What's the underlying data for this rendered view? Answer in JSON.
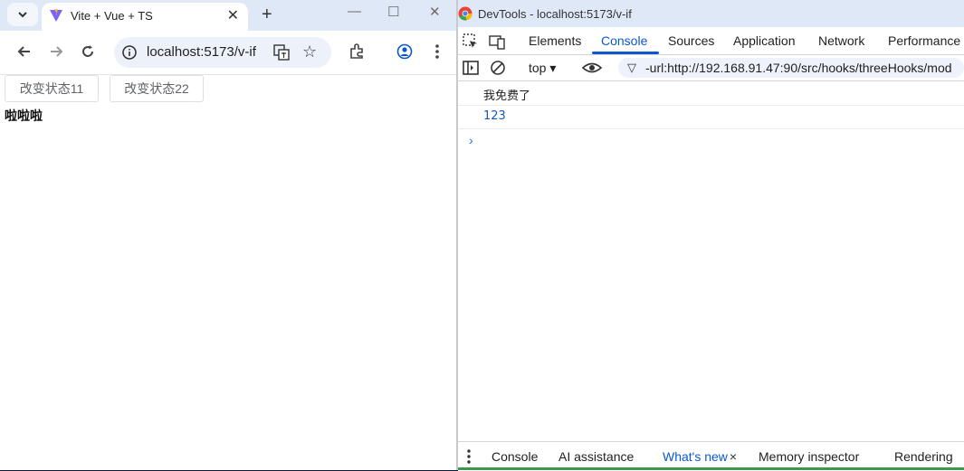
{
  "browser": {
    "tab_title": "Vite + Vue + TS",
    "url": "localhost:5173/v-if",
    "page": {
      "buttons": [
        "改变状态11",
        "改变状态22"
      ],
      "text": "啦啦啦"
    }
  },
  "devtools": {
    "window_title": "DevTools - localhost:5173/v-if",
    "panel_tabs": [
      "Elements",
      "Console",
      "Sources",
      "Application",
      "Network",
      "Performance"
    ],
    "active_panel": "Console",
    "context": "top",
    "filter": "-url:http://192.168.91.47:90/src/hooks/threeHooks/mod",
    "console_lines": [
      {
        "text": "我免费了",
        "color": "#1f1f1f"
      },
      {
        "text": "123",
        "color": "#1a57b8"
      }
    ],
    "prompt": "›",
    "drawer_tabs": [
      "Console",
      "AI assistance",
      "What's new",
      "Memory inspector",
      "Rendering"
    ],
    "active_drawer": "What's new",
    "drawer_close": "×"
  },
  "icons": {
    "tab_search": "chevron-down-icon",
    "new_tab": "+",
    "minimize": "—",
    "maximize": "☐",
    "close": "✕"
  },
  "colors": {
    "accent": "#0b57d0",
    "tabstrip": "#dfe8f6"
  }
}
